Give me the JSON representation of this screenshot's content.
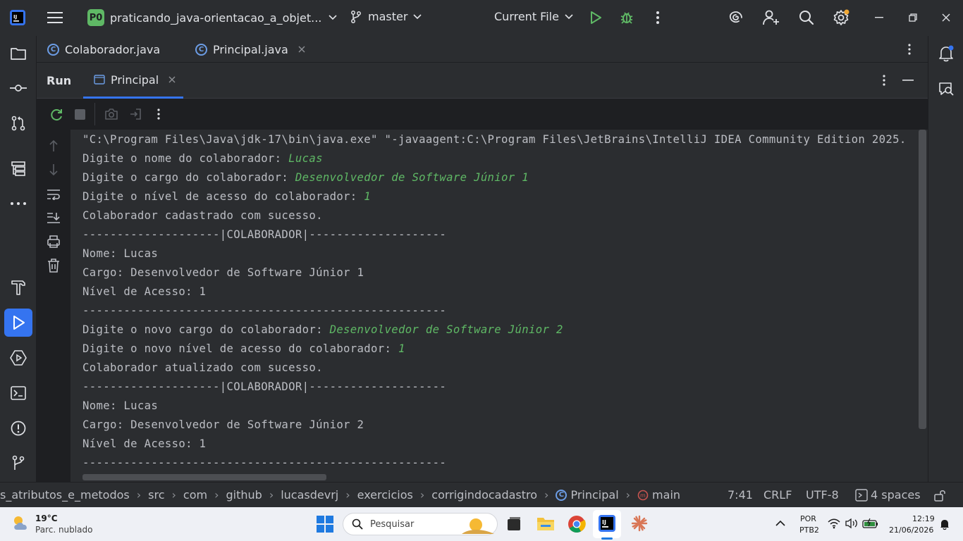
{
  "titlebar": {
    "project_badge": "P0",
    "project_name": "praticando_java-orientacao_a_objet...",
    "branch": "master",
    "run_config": "Current File"
  },
  "editor_tabs": [
    {
      "label": "Colaborador.java"
    },
    {
      "label": "Principal.java"
    }
  ],
  "run_panel": {
    "title": "Run",
    "tab_label": "Principal"
  },
  "console": {
    "lines": [
      {
        "text": "\"C:\\Program Files\\Java\\jdk-17\\bin\\java.exe\" \"-javaagent:C:\\Program Files\\JetBrains\\IntelliJ IDEA Community Edition 2025.",
        "input": ""
      },
      {
        "text": "Digite o nome do colaborador: ",
        "input": "Lucas"
      },
      {
        "text": "Digite o cargo do colaborador: ",
        "input": "Desenvolvedor de Software Júnior 1"
      },
      {
        "text": "Digite o nível de acesso do colaborador: ",
        "input": "1"
      },
      {
        "text": "Colaborador cadastrado com sucesso.",
        "input": ""
      },
      {
        "text": "--------------------|COLABORADOR|--------------------",
        "input": ""
      },
      {
        "text": "Nome: Lucas",
        "input": ""
      },
      {
        "text": "Cargo: Desenvolvedor de Software Júnior 1",
        "input": ""
      },
      {
        "text": "Nível de Acesso: 1",
        "input": ""
      },
      {
        "text": "-----------------------------------------------------",
        "input": ""
      },
      {
        "text": "Digite o novo cargo do colaborador: ",
        "input": "Desenvolvedor de Software Júnior 2"
      },
      {
        "text": "Digite o novo nível de acesso do colaborador: ",
        "input": "1"
      },
      {
        "text": "Colaborador atualizado com sucesso.",
        "input": ""
      },
      {
        "text": "--------------------|COLABORADOR|--------------------",
        "input": ""
      },
      {
        "text": "Nome: Lucas",
        "input": ""
      },
      {
        "text": "Cargo: Desenvolvedor de Software Júnior 2",
        "input": ""
      },
      {
        "text": "Nível de Acesso: 1",
        "input": ""
      },
      {
        "text": "-----------------------------------------------------",
        "input": ""
      }
    ]
  },
  "statusbar": {
    "breadcrumbs": [
      "s_atributos_e_metodos",
      "src",
      "com",
      "github",
      "lucasdevrj",
      "exercicios",
      "corrigindocadastro",
      "Principal",
      "main"
    ],
    "position": "7:41",
    "line_ending": "CRLF",
    "encoding": "UTF-8",
    "indent": "4 spaces"
  },
  "taskbar": {
    "weather_temp": "19°C",
    "weather_desc": "Parc. nublado",
    "search_placeholder": "Pesquisar",
    "lang": "POR",
    "layout": "PTB2",
    "time": "12:19",
    "date": "21/06/2026"
  },
  "colors": {
    "accent": "#3574f0",
    "input_green": "#5fb865",
    "background": "#1e1f22",
    "panel": "#2b2d30"
  }
}
